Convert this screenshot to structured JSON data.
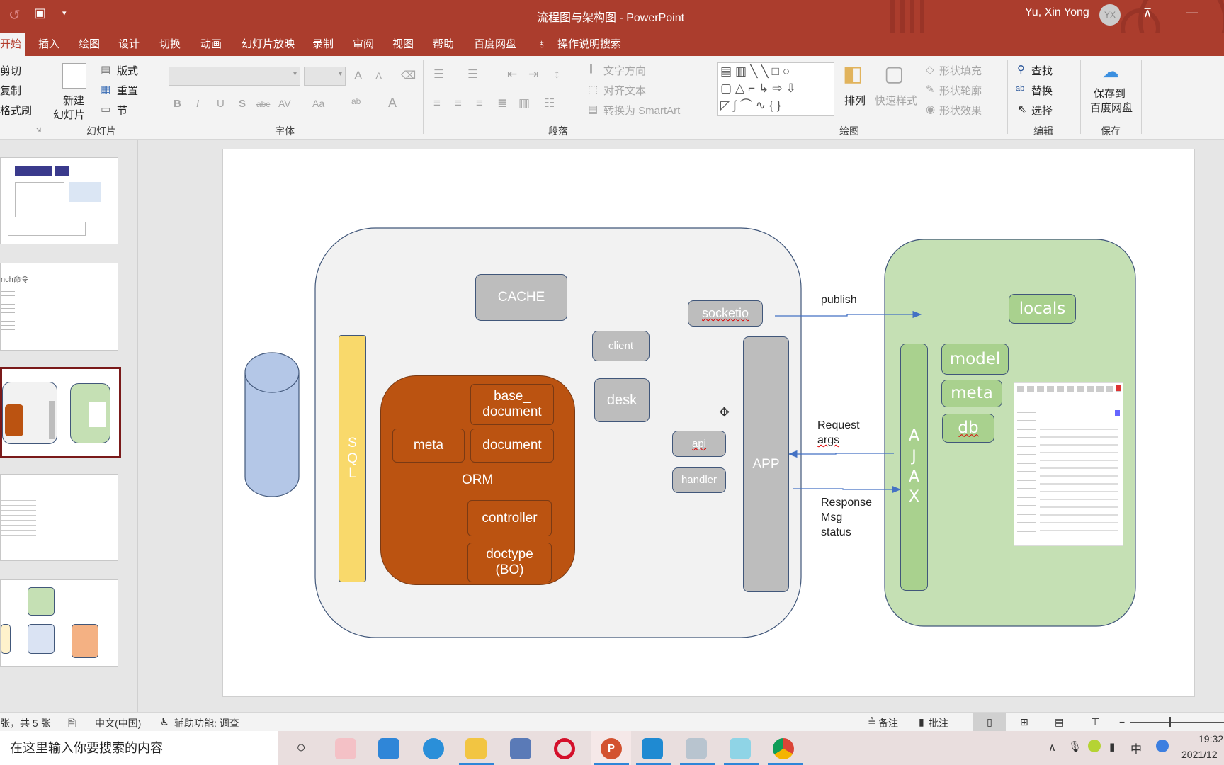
{
  "window": {
    "title": "流程图与架构图  -  PowerPoint",
    "user_name": "Yu, Xin Yong",
    "user_initials": "YX",
    "accent_color": "#ab3d2d",
    "quick_access": [
      "undo-icon",
      "present-from-start-icon",
      "customize-dropdown-icon"
    ]
  },
  "tabs": [
    {
      "label": "开始",
      "selected": true
    },
    {
      "label": "插入"
    },
    {
      "label": "绘图"
    },
    {
      "label": "设计"
    },
    {
      "label": "切换"
    },
    {
      "label": "动画"
    },
    {
      "label": "幻灯片放映"
    },
    {
      "label": "录制"
    },
    {
      "label": "审阅"
    },
    {
      "label": "视图"
    },
    {
      "label": "帮助"
    },
    {
      "label": "百度网盘"
    }
  ],
  "tell_me": "操作说明搜索",
  "ribbon": {
    "clipboard": {
      "cut": "剪切",
      "copy": "复制",
      "format_painter": "格式刷"
    },
    "slides": {
      "new_slide": "新建",
      "new_slide2": "幻灯片",
      "layout": "版式",
      "reset": "重置",
      "section": "节",
      "label": "幻灯片"
    },
    "font": {
      "label": "字体",
      "font_name": "",
      "font_size": "",
      "buttons": [
        "B",
        "I",
        "U",
        "S",
        "abc",
        "AV",
        "Aa",
        "ab",
        "A"
      ],
      "grow": "A",
      "shrink": "A"
    },
    "paragraph": {
      "label": "段落",
      "text_direction": "文字方向",
      "align_text": "对齐文本",
      "smartart": "转换为 SmartArt"
    },
    "drawing": {
      "label": "绘图",
      "arrange": "排列",
      "quick_styles": "快速样式",
      "shape_fill": "形状填充",
      "shape_outline": "形状轮廓",
      "shape_effects": "形状效果"
    },
    "editing": {
      "label": "编辑",
      "find": "查找",
      "replace": "替换",
      "select": "选择"
    },
    "save": {
      "label": "保存",
      "save_to": "保存到",
      "save_to2": "百度网盘"
    }
  },
  "thumbnails": [
    {
      "index": 1
    },
    {
      "index": 2,
      "text": "nch命令"
    },
    {
      "index": 3,
      "selected": true
    },
    {
      "index": 4
    },
    {
      "index": 5
    }
  ],
  "slide": {
    "sql": [
      "S",
      "Q",
      "L"
    ],
    "cache": "CACHE",
    "orm": "ORM",
    "base_document": "base_\ndocument",
    "meta": "meta",
    "document": "document",
    "controller": "controller",
    "doctype": "doctype\n(BO)",
    "socketio": "socketio",
    "client": "client",
    "desk": "desk",
    "api": "api",
    "handler": "handler",
    "app": "APP",
    "publish": "publish",
    "request": "Request",
    "request_args": "args",
    "response": "Response",
    "response_msg": "Msg",
    "response_status": "status",
    "ajax": [
      "A",
      "J",
      "A",
      "X"
    ],
    "locals": "locals",
    "model": "model",
    "meta2": "meta",
    "db": "db",
    "colors": {
      "server_bg": "#f2f2f2",
      "client_bg": "#c5e0b4",
      "orm": "#bb5311",
      "sql": "#f9d96b",
      "db_cylinder": "#b4c7e7",
      "component": "#bdbdbd",
      "client_component": "#a9d18e"
    }
  },
  "statusbar": {
    "slide_count": "张，共 5 张",
    "language": "中文(中国)",
    "accessibility": "辅助功能: 调查",
    "notes": "备注",
    "comments": "批注"
  },
  "taskbar": {
    "search_placeholder": "在这里输入你要搜索的内容",
    "apps": [
      "cortana-icon",
      "snipping-icon",
      "mail-icon",
      "feishu-icon",
      "file-explorer-icon",
      "remote-desktop-icon",
      "opera-icon",
      "powerpoint-icon",
      "vscode-icon",
      "task-manager-icon",
      "live2d-icon",
      "chrome-icon"
    ],
    "time": "19:32",
    "date": "2021/12",
    "ime": "中"
  }
}
